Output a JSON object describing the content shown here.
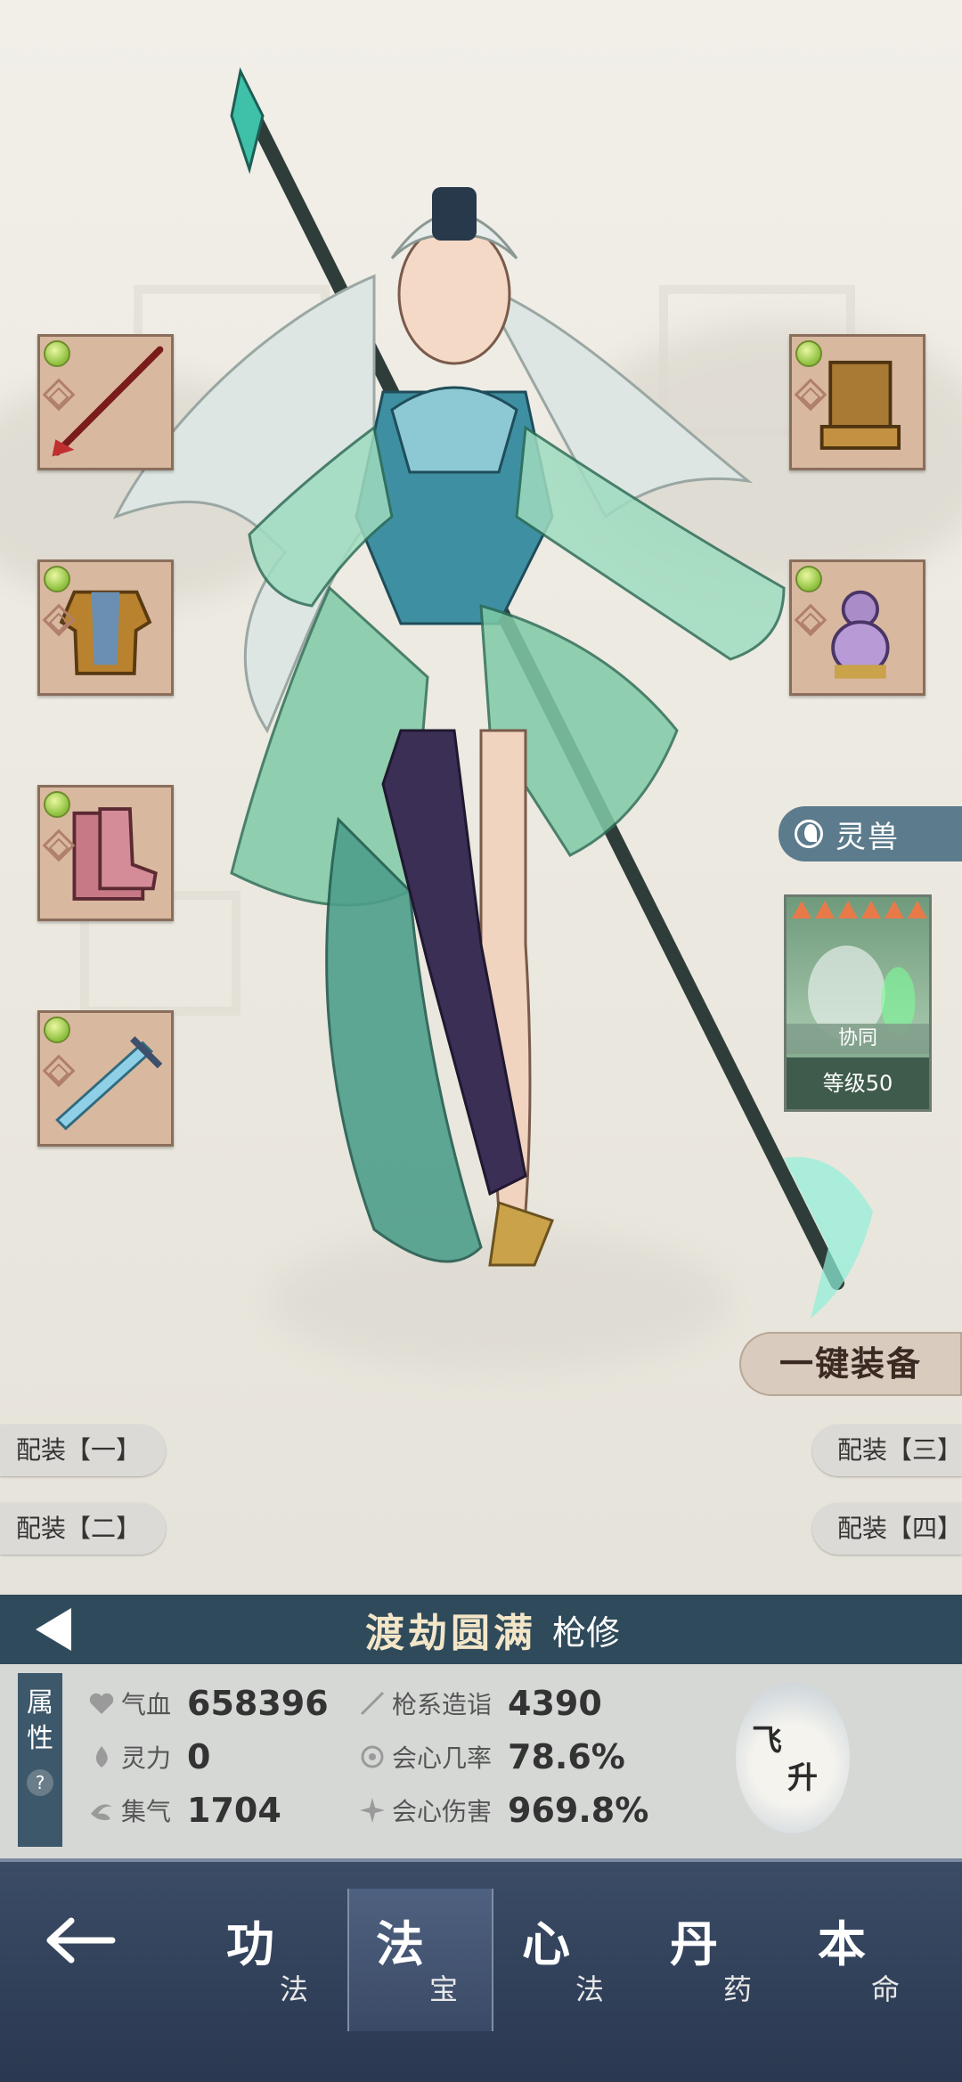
{
  "equipment": {
    "left": [
      "spear-icon",
      "armor-icon",
      "boots-icon",
      "sword-icon"
    ],
    "right": [
      "seal-icon",
      "gourd-icon"
    ]
  },
  "beast": {
    "tab_label": "灵兽",
    "tag": "协同",
    "level": "等级50"
  },
  "actions": {
    "one_key_equip": "一键装备",
    "loadout_1": "配装【一】",
    "loadout_2": "配装【二】",
    "loadout_3": "配装【三】",
    "loadout_4": "配装【四】"
  },
  "banner": {
    "realm": "渡劫圆满",
    "class": "枪修"
  },
  "attributes": {
    "side_label": [
      "属",
      "性"
    ],
    "help": "?",
    "stats": [
      {
        "label": "气血",
        "value": "658396",
        "icon": "heart-icon"
      },
      {
        "label": "灵力",
        "value": "0",
        "icon": "spirit-flame-icon"
      },
      {
        "label": "集气",
        "value": "1704",
        "icon": "swirl-icon"
      },
      {
        "label": "枪系造诣",
        "value": "4390",
        "icon": "spear-mastery-icon"
      },
      {
        "label": "会心几率",
        "value": "78.6%",
        "icon": "crit-rate-icon"
      },
      {
        "label": "会心伤害",
        "value": "969.8%",
        "icon": "crit-damage-icon"
      }
    ],
    "ascend": [
      "飞",
      "升"
    ]
  },
  "nav": {
    "tabs": [
      {
        "big": "功",
        "small": "法"
      },
      {
        "big": "法",
        "small": "宝"
      },
      {
        "big": "心",
        "small": "法"
      },
      {
        "big": "丹",
        "small": "药"
      },
      {
        "big": "本",
        "small": "命"
      }
    ],
    "active_index": 1
  }
}
